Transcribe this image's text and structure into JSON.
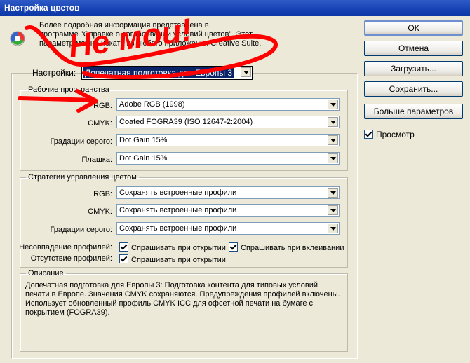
{
  "window": {
    "title": "Настройка цветов"
  },
  "info": {
    "lines": [
      "Более подробная информация представлена в",
      "программе \"Справке о согласовании условий цветов\". Этот",
      "параметр можно искать из любого приложения Creative Suite."
    ]
  },
  "settings": {
    "label": "Настройки:",
    "value": "Допечатная подготовка для Европы 3"
  },
  "workspaces": {
    "legend": "Рабочие пространства",
    "rows": [
      {
        "label": "RGB:",
        "value": "Adobe RGB (1998)"
      },
      {
        "label": "CMYK:",
        "value": "Coated FOGRA39 (ISO 12647-2:2004)"
      },
      {
        "label": "Градации серого:",
        "value": "Dot Gain 15%"
      },
      {
        "label": "Плашка:",
        "value": "Dot Gain 15%"
      }
    ]
  },
  "policies": {
    "legend": "Стратегии управления цветом",
    "rows": [
      {
        "label": "RGB:",
        "value": "Сохранять встроенные профили"
      },
      {
        "label": "CMYK:",
        "value": "Сохранять встроенные профили"
      },
      {
        "label": "Градации серого:",
        "value": "Сохранять встроенные профили"
      }
    ],
    "mismatch_label": "Несовпадение профилей:",
    "mismatch_open": "Спрашивать при открытии",
    "mismatch_paste": "Спрашивать при вклеивании",
    "missing_label": "Отсутствие профилей:",
    "missing_open": "Спрашивать при открытии"
  },
  "description": {
    "legend": "Описание",
    "text": "Допечатная подготовка для Европы 3:  Подготовка контента для типовых условий печати в Европе. Значения CMYK сохраняются. Предупреждения профилей включены. Использует обновленный профиль CMYK ICC для офсетной печати на бумаге с покрытием (FOGRA39)."
  },
  "buttons": {
    "ok": "ОК",
    "cancel": "Отмена",
    "load": "Загрузить...",
    "save": "Сохранить...",
    "more": "Больше параметров"
  },
  "preview": {
    "label": "Просмотр"
  },
  "annotation": {
    "text": "Не мои!",
    "color": "#ff0000"
  }
}
